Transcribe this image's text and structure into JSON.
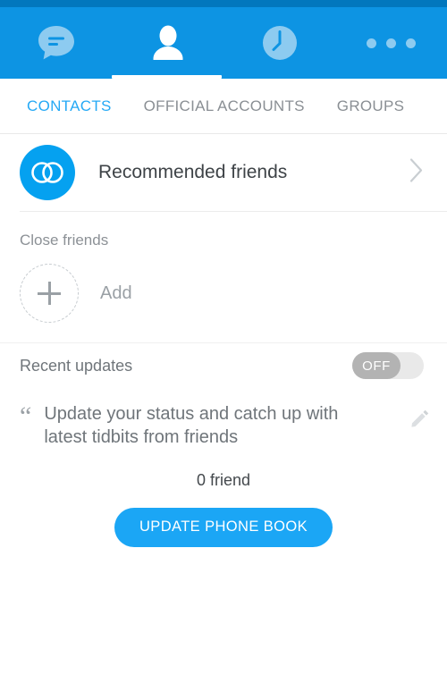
{
  "theme": {
    "status_bar_color": "#0277bd",
    "header_color": "#0d94e3",
    "accent_blue": "#25a9f5",
    "avatar_blue": "#05a1f0",
    "button_blue": "#1ba6f5",
    "inactive_icon_blue": "#8dcbf0",
    "muted_text": "#8c9196",
    "toggle_track": "#e9e9e9",
    "toggle_knob": "#b3b3b3"
  },
  "topnav": {
    "items": [
      {
        "icon": "chat-bubble-icon",
        "name": "chats",
        "active": false
      },
      {
        "icon": "person-icon",
        "name": "contacts",
        "active": true
      },
      {
        "icon": "clock-icon",
        "name": "recent",
        "active": false
      },
      {
        "icon": "more-dots-icon",
        "name": "more",
        "active": false
      }
    ]
  },
  "tabs": [
    {
      "label": "CONTACTS",
      "active": true
    },
    {
      "label": "OFFICIAL ACCOUNTS",
      "active": false
    },
    {
      "label": "GROUPS",
      "active": false
    }
  ],
  "recommended": {
    "label": "Recommended friends",
    "avatar_icon": "two-overlapping-circles-icon",
    "chevron_icon": "chevron-right-icon"
  },
  "close_friends": {
    "section_label": "Close friends",
    "add_label": "Add",
    "add_icon": "plus-icon"
  },
  "recent_updates": {
    "label": "Recent updates",
    "toggle_state": "OFF"
  },
  "status_quote": {
    "quote_icon": "quote-mark-icon",
    "text": "Update your status and catch up with latest tidbits from friends",
    "edit_icon": "pencil-icon"
  },
  "friends": {
    "count_label": "0 friend",
    "cta_label": "UPDATE PHONE BOOK"
  }
}
